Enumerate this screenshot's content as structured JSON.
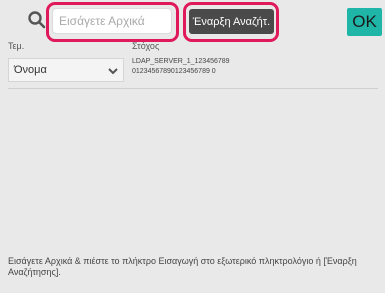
{
  "search": {
    "placeholder": "Εισάγετε Αρχικά",
    "start_label": "Έναρξη Αναζήτ."
  },
  "ok_label": "OK",
  "headers": {
    "type": "Τεμ.",
    "target": "Στόχος"
  },
  "row": {
    "type_value": "Όνομα",
    "target_line1": "LDAP_SERVER_1_123456789",
    "target_line2": "01234567890123456789 0"
  },
  "footer_text": "Εισάγετε Αρχικά & πιέστε το πλήκτρο Εισαγωγή στο εξωτερικό πληκτρολόγιο ή [Έναρξη Αναζήτησης].",
  "colors": {
    "highlight": "#e0195a",
    "ok": "#1fb6a8",
    "start_button": "#4a4a4a"
  },
  "icons": [
    "search-icon",
    "chevron-down-icon"
  ]
}
